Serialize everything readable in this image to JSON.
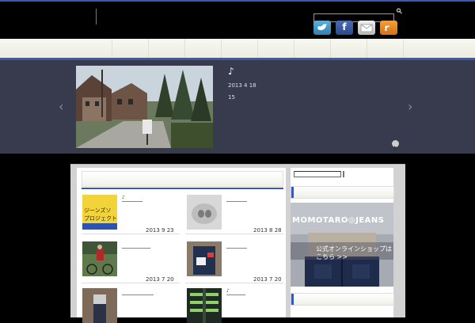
{
  "header": {
    "search_placeholder": "",
    "social": [
      {
        "name": "twitter",
        "icon": "twitter-bird-icon",
        "glyph": ""
      },
      {
        "name": "facebook",
        "icon": "facebook-icon",
        "glyph": "f"
      },
      {
        "name": "mail",
        "icon": "mail-icon",
        "glyph": ""
      },
      {
        "name": "rss",
        "icon": "rss-icon",
        "glyph": "RSS"
      }
    ]
  },
  "slider": {
    "title": "♪",
    "date": "2013 4 18",
    "comments": "15"
  },
  "posts": [
    {
      "date": "2013 9 23",
      "thumb_text": "ジーンズソ\nプロジェクト"
    },
    {
      "date": "2013 8 28"
    },
    {
      "date": "2013 7 20"
    },
    {
      "date": "2013 7 20"
    },
    {
      "date": ""
    },
    {
      "date": ""
    }
  ],
  "post_titles": [
    "♪",
    "",
    "",
    "",
    "",
    "♪"
  ],
  "sidebar": {
    "banner_brand": "MOMOTARO◎JEANS",
    "banner_text": "公式オンラインショップは\nこちら >>"
  },
  "colors": {
    "accent": "#3a58b8",
    "slider_bg": "#383a4e",
    "panel_bg": "#d2d2d2"
  }
}
